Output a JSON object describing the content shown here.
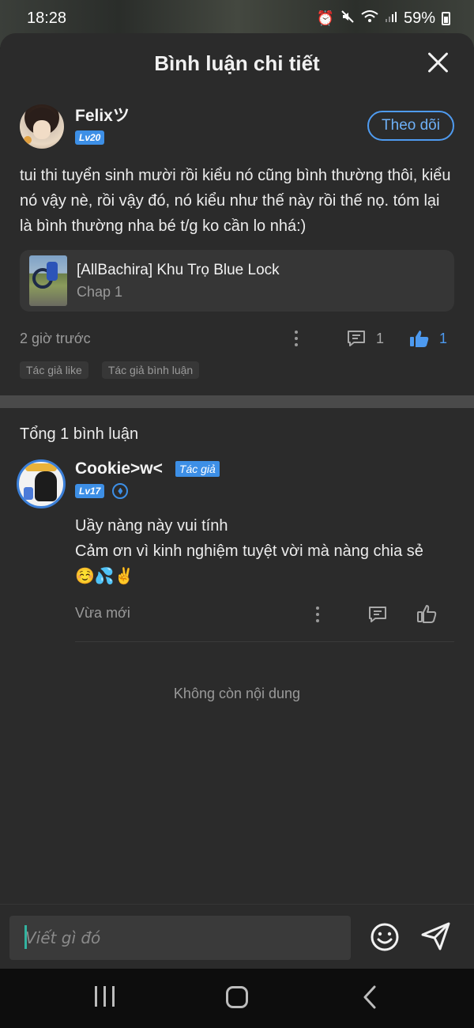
{
  "status": {
    "time": "18:28",
    "battery": "59%",
    "icons": [
      "alarm-icon",
      "mute-icon",
      "wifi-icon",
      "signal-icon",
      "battery-icon"
    ]
  },
  "sheet": {
    "title": "Bình luận chi tiết"
  },
  "post": {
    "username": "Felixツ",
    "level": "Lv20",
    "follow_label": "Theo dõi",
    "text": "tui thi tuyển sinh mười rồi kiểu nó cũng bình thường thôi, kiểu nó vậy nè, rồi vậy đó, nó kiểu như thế này rồi thế nọ. tóm lại là bình thường nha bé t/g ko cần lo nhá:)",
    "chapter": {
      "title": "[AllBachira] Khu Trọ Blue Lock",
      "subtitle": "Chap 1"
    },
    "time": "2 giờ trước",
    "reply_count": "1",
    "like_count": "1",
    "tags": [
      "Tác giả like",
      "Tác giả bình luận"
    ]
  },
  "comments": {
    "total_label": "Tổng 1 bình luận",
    "items": [
      {
        "name": "Cookie>w<",
        "author_badge": "Tác giả",
        "level": "Lv17",
        "line1": "Uầy nàng này vui tính",
        "line2": "Cảm ơn vì kinh nghiệm tuyệt vời mà nàng chia sẻ",
        "emojis": "☺️💦✌️",
        "time": "Vừa mới"
      }
    ],
    "end_label": "Không còn nội dung"
  },
  "input": {
    "placeholder": "Viết gì đó"
  },
  "colors": {
    "accent": "#3d8fe6",
    "background": "#2b2b2b",
    "like": "#4d9af0"
  }
}
